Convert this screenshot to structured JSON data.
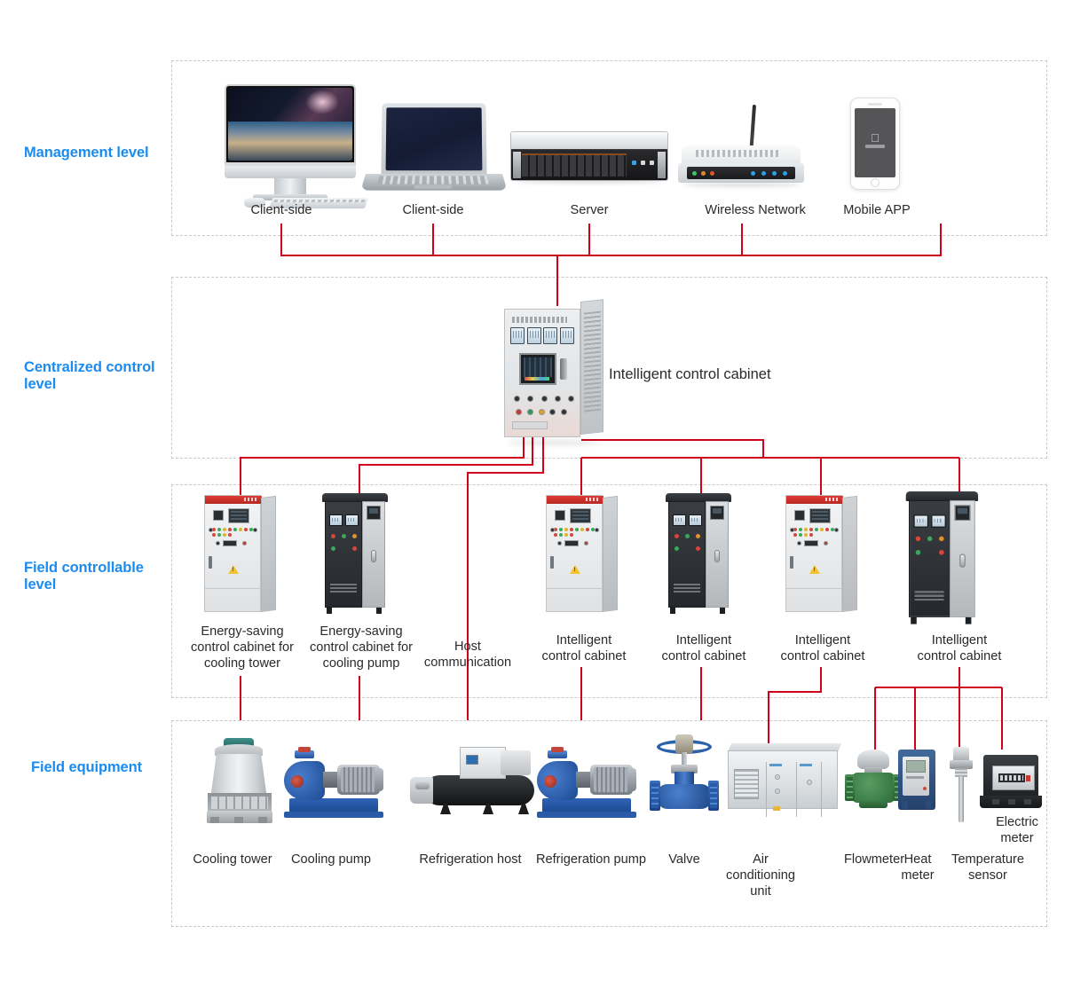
{
  "diagram": {
    "title": "Intelligent building HVAC control system architecture",
    "accent_blue": "#1a8cf0",
    "wire_red": "#d0021b",
    "band_border": "#c9c9c9"
  },
  "levels": [
    {
      "key": "management",
      "label": "Management level"
    },
    {
      "key": "centralized",
      "label": "Centralized control\nlevel"
    },
    {
      "key": "field_control",
      "label": "Field controllable\nlevel"
    },
    {
      "key": "field_equipment",
      "label": "Field equipment"
    }
  ],
  "management_level": {
    "nodes": [
      {
        "id": "client-desktop",
        "label": "Client-side",
        "icon": "imac-icon"
      },
      {
        "id": "client-laptop",
        "label": "Client-side",
        "icon": "laptop-icon"
      },
      {
        "id": "server",
        "label": "Server",
        "icon": "server-icon"
      },
      {
        "id": "wireless-network",
        "label": "Wireless Network",
        "icon": "router-icon"
      },
      {
        "id": "mobile-app",
        "label": "Mobile APP",
        "icon": "smartphone-icon"
      }
    ]
  },
  "centralized_control_level": {
    "node": {
      "id": "central-cabinet",
      "label": "Intelligent control cabinet",
      "icon": "control-cabinet-icon"
    }
  },
  "field_controllable_level": {
    "nodes": [
      {
        "id": "cabinet-cooling-tower",
        "label": "Energy-saving\ncontrol cabinet for\ncooling tower",
        "icon": "light-cabinet-icon"
      },
      {
        "id": "cabinet-cooling-pump",
        "label": "Energy-saving\ncontrol cabinet for\ncooling pump",
        "icon": "dark-cabinet-icon"
      },
      {
        "id": "host-communication",
        "label": "Host\ncommunication",
        "icon": "link-icon"
      },
      {
        "id": "cabinet-intelligent-1",
        "label": "Intelligent\ncontrol cabinet",
        "icon": "light-cabinet-icon"
      },
      {
        "id": "cabinet-intelligent-2",
        "label": "Intelligent\ncontrol cabinet",
        "icon": "dark-cabinet-icon"
      },
      {
        "id": "cabinet-intelligent-3",
        "label": "Intelligent\ncontrol cabinet",
        "icon": "light-cabinet-icon"
      },
      {
        "id": "cabinet-intelligent-4",
        "label": "Intelligent\ncontrol cabinet",
        "icon": "dark-cabinet-icon"
      }
    ]
  },
  "field_equipment_level": {
    "nodes": [
      {
        "id": "cooling-tower",
        "label": "Cooling tower",
        "icon": "cooling-tower-icon"
      },
      {
        "id": "cooling-pump",
        "label": "Cooling pump",
        "icon": "pump-icon"
      },
      {
        "id": "refrigeration-host",
        "label": "Refrigeration host",
        "icon": "chiller-icon"
      },
      {
        "id": "refrigeration-pump",
        "label": "Refrigeration pump",
        "icon": "pump-icon"
      },
      {
        "id": "valve",
        "label": "Valve",
        "icon": "gate-valve-icon"
      },
      {
        "id": "air-conditioning-unit",
        "label": "Air\nconditioning unit",
        "icon": "ahu-icon"
      },
      {
        "id": "flowmeter",
        "label": "Flowmeter",
        "icon": "flowmeter-icon"
      },
      {
        "id": "heat-meter",
        "label": "Heat\nmeter",
        "icon": "heat-meter-icon"
      },
      {
        "id": "temperature-sensor",
        "label": "Temperature\nsensor",
        "icon": "temperature-sensor-icon"
      },
      {
        "id": "electric-meter",
        "label": "Electric\nmeter",
        "icon": "electric-meter-icon"
      }
    ]
  }
}
